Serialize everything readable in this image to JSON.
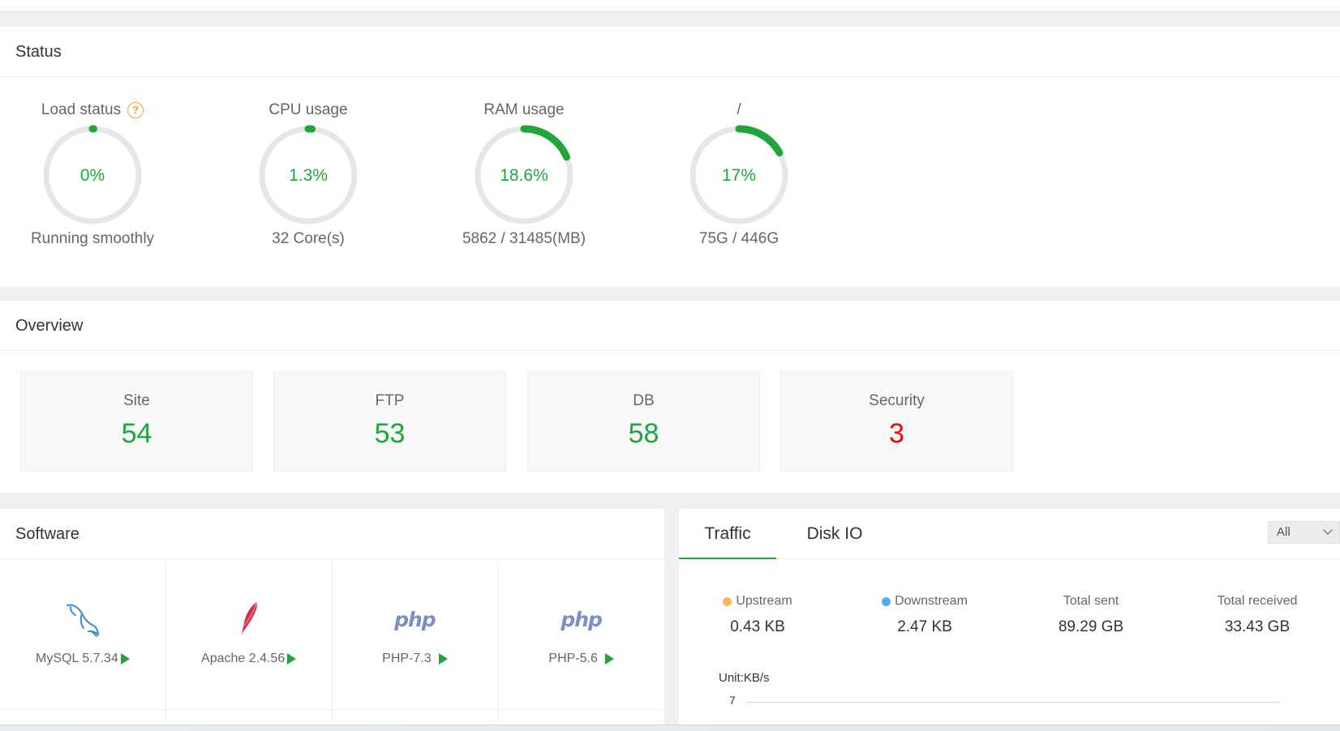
{
  "status": {
    "title": "Status",
    "gauges": [
      {
        "label": "Load status",
        "value": "0%",
        "percent": 0,
        "sub": "Running smoothly",
        "help": "?"
      },
      {
        "label": "CPU usage",
        "value": "1.3%",
        "percent": 1.3,
        "sub": "32 Core(s)"
      },
      {
        "label": "RAM usage",
        "value": "18.6%",
        "percent": 18.6,
        "sub": "5862 / 31485(MB)"
      },
      {
        "label": "/",
        "value": "17%",
        "percent": 17,
        "sub": "75G / 446G"
      }
    ]
  },
  "overview": {
    "title": "Overview",
    "cards": [
      {
        "label": "Site",
        "value": "54"
      },
      {
        "label": "FTP",
        "value": "53"
      },
      {
        "label": "DB",
        "value": "58"
      },
      {
        "label": "Security",
        "value": "3"
      }
    ]
  },
  "software": {
    "title": "Software",
    "items": [
      {
        "name": "MySQL 5.7.34",
        "icon": "mysql-dolphin-icon"
      },
      {
        "name": "Apache 2.4.56",
        "icon": "apache-feather-icon"
      },
      {
        "name": "PHP-7.3",
        "icon": "php-logo-icon",
        "logo_text": "php"
      },
      {
        "name": "PHP-5.6",
        "icon": "php-logo-icon",
        "logo_text": "php"
      }
    ]
  },
  "traffic": {
    "tabs": [
      "Traffic",
      "Disk IO"
    ],
    "active_tab": "Traffic",
    "select_value": "All",
    "stats": [
      {
        "label": "Upstream",
        "value": "0.43 KB",
        "dot_color": "#f7b851"
      },
      {
        "label": "Downstream",
        "value": "2.47 KB",
        "dot_color": "#52a9ff"
      },
      {
        "label": "Total sent",
        "value": "89.29 GB"
      },
      {
        "label": "Total received",
        "value": "33.43 GB"
      }
    ],
    "unit_label": "Unit:KB/s",
    "y_tick": "7"
  },
  "colors": {
    "accent": "#20a53a",
    "danger": "#ef0808",
    "track": "#e6e6e6",
    "help": "#f0a030"
  }
}
